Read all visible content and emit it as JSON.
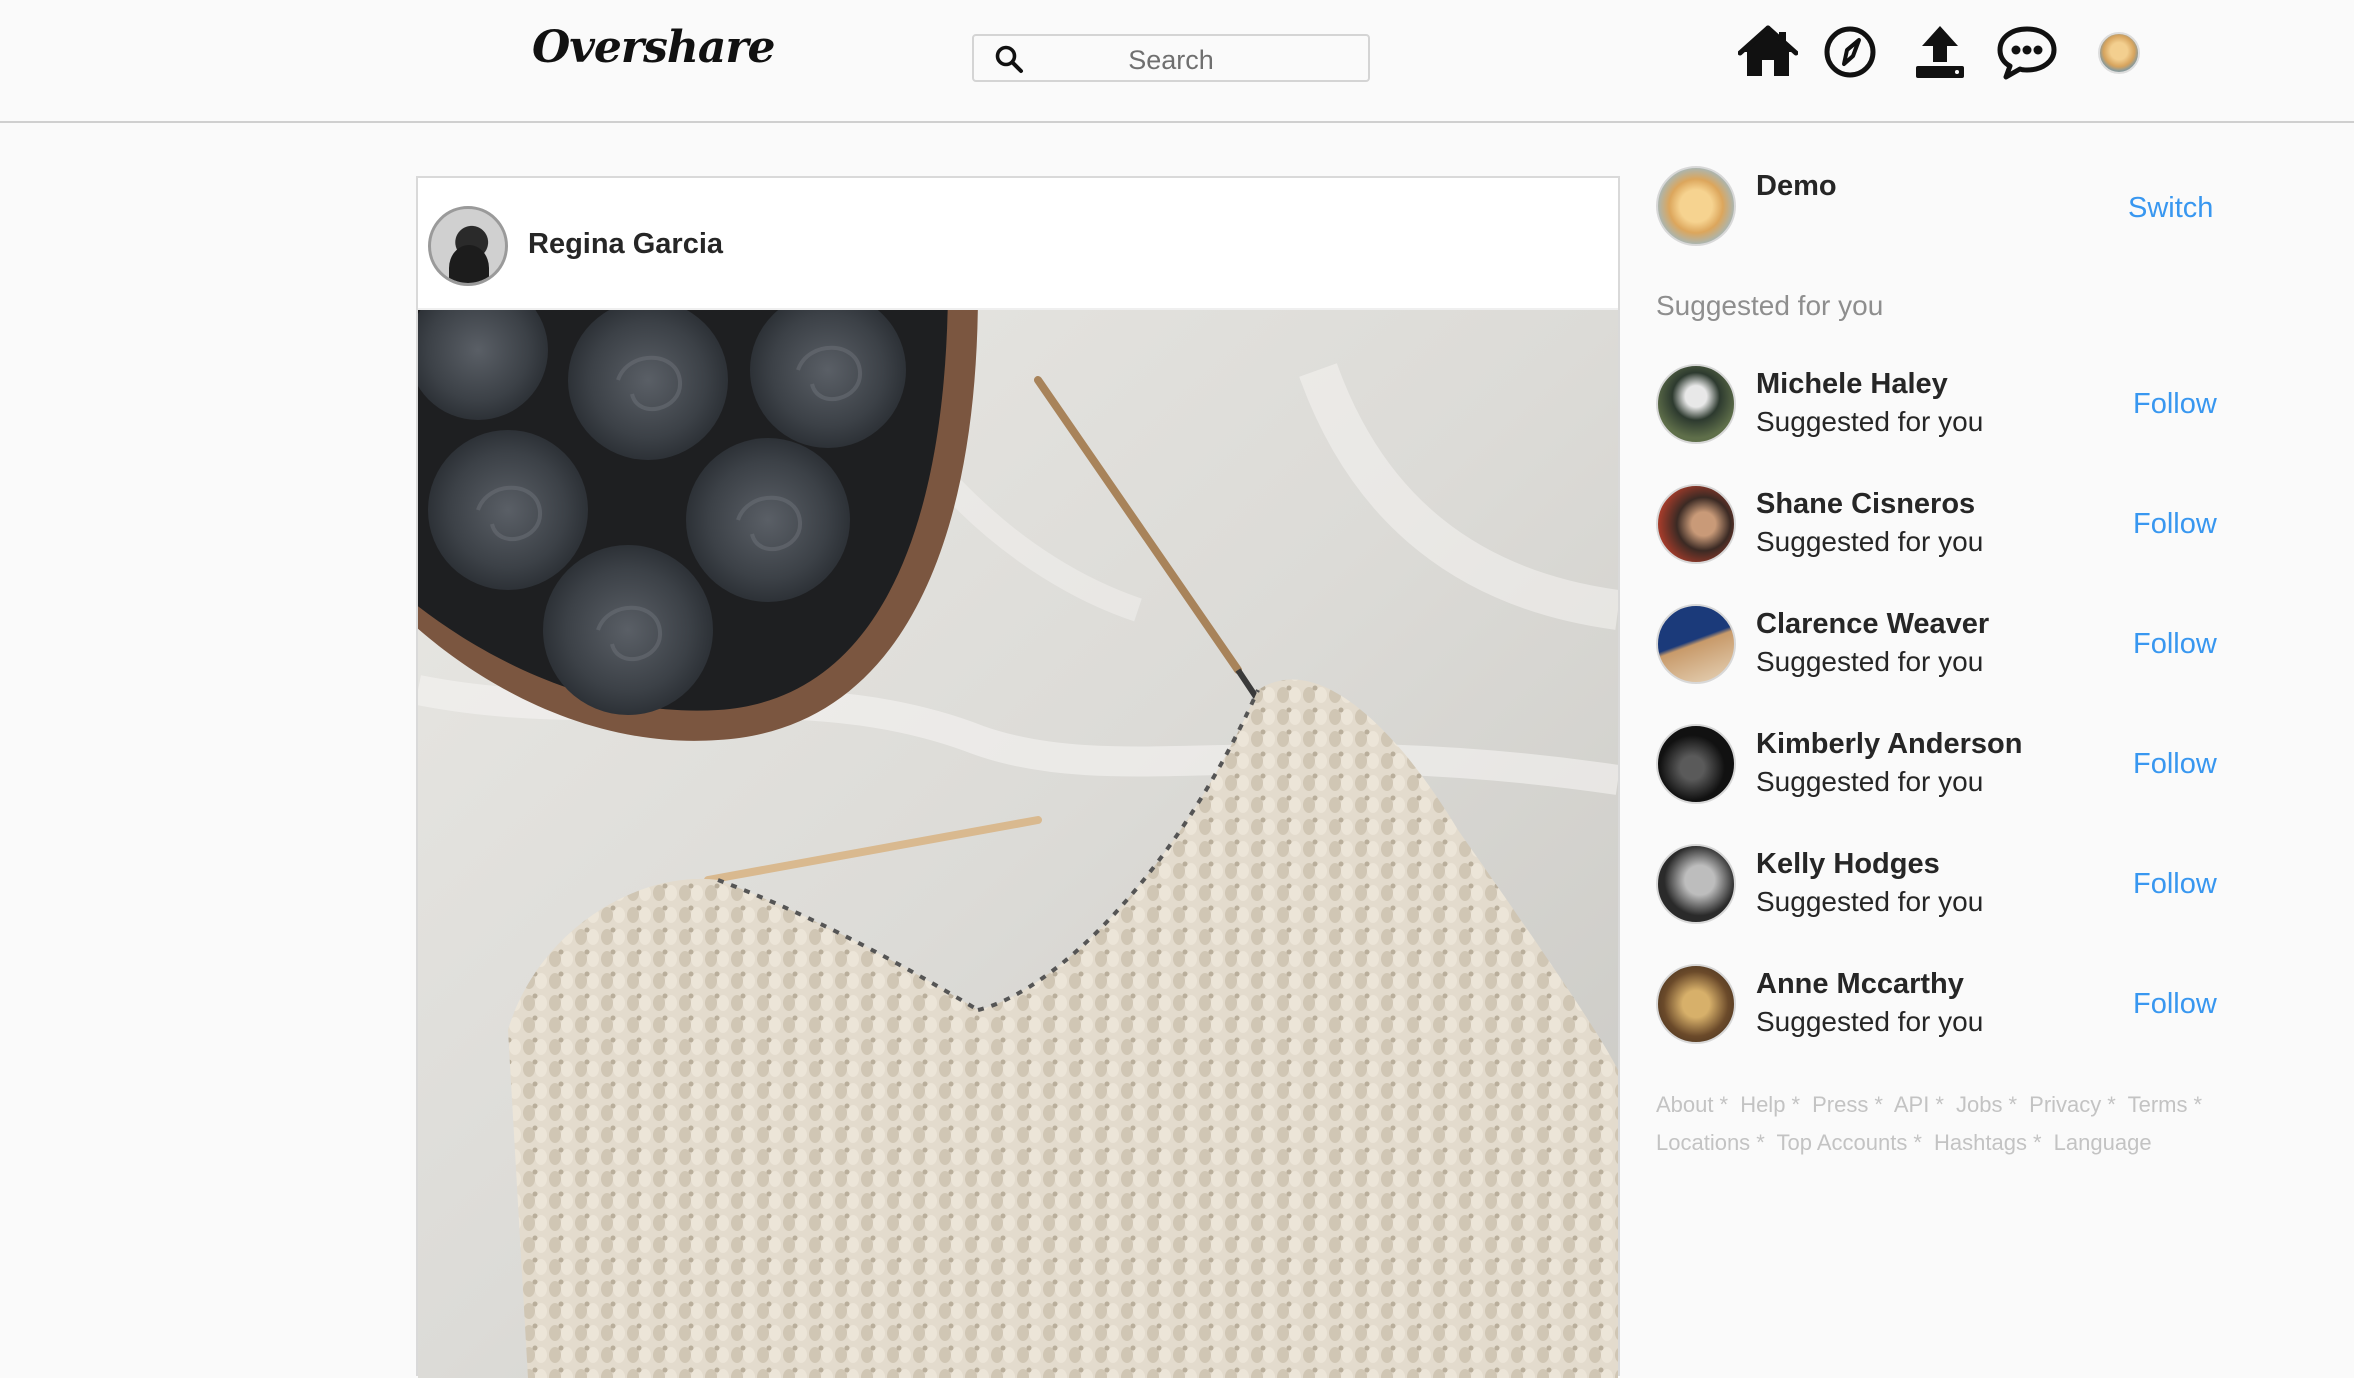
{
  "header": {
    "logo": "Overshare",
    "search_placeholder": "Search",
    "icons": [
      "home-icon",
      "explore-icon",
      "upload-icon",
      "messages-icon",
      "profile-avatar"
    ]
  },
  "post": {
    "username": "Regina Garcia"
  },
  "sidebar": {
    "me": {
      "name": "Demo",
      "switch_label": "Switch"
    },
    "suggest_heading": "Suggested for you",
    "suggestions": [
      {
        "name": "Michele Haley",
        "sub": "Suggested for you",
        "action": "Follow"
      },
      {
        "name": "Shane Cisneros",
        "sub": "Suggested for you",
        "action": "Follow"
      },
      {
        "name": "Clarence Weaver",
        "sub": "Suggested for you",
        "action": "Follow"
      },
      {
        "name": "Kimberly Anderson",
        "sub": "Suggested for you",
        "action": "Follow"
      },
      {
        "name": "Kelly Hodges",
        "sub": "Suggested for you",
        "action": "Follow"
      },
      {
        "name": "Anne Mccarthy",
        "sub": "Suggested for you",
        "action": "Follow"
      }
    ],
    "footer_links": [
      "About",
      "Help",
      "Press",
      "API",
      "Jobs",
      "Privacy",
      "Terms",
      "Locations",
      "Top Accounts",
      "Hashtags",
      "Language"
    ]
  },
  "colors": {
    "link": "#3897f0",
    "muted": "#8e8e8e",
    "footer": "#c3c3c3"
  }
}
